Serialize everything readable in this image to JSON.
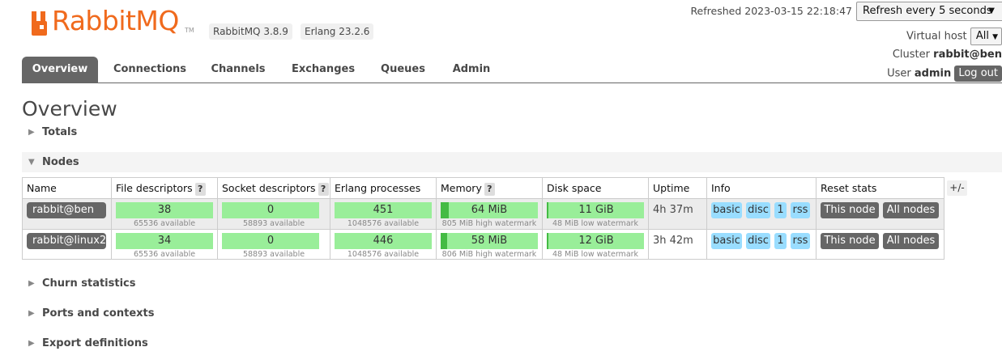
{
  "header": {
    "logo_text": "RabbitMQ",
    "logo_tm": "TM",
    "rabbitmq_version": "RabbitMQ 3.8.9",
    "erlang_version": "Erlang 23.2.6",
    "refreshed_label": "Refreshed 2023-03-15 22:18:47",
    "refresh_interval": "Refresh every 5 seconds",
    "virtual_host_label": "Virtual host",
    "virtual_host_value": "All",
    "cluster_label": "Cluster",
    "cluster_value": "rabbit@ben",
    "user_label": "User",
    "user_value": "admin",
    "logout_label": "Log out"
  },
  "tabs": [
    {
      "label": "Overview",
      "active": true
    },
    {
      "label": "Connections"
    },
    {
      "label": "Channels"
    },
    {
      "label": "Exchanges"
    },
    {
      "label": "Queues"
    },
    {
      "label": "Admin"
    }
  ],
  "page_title": "Overview",
  "sections": {
    "totals": "Totals",
    "nodes": "Nodes",
    "churn": "Churn statistics",
    "ports": "Ports and contexts",
    "export": "Export definitions"
  },
  "table": {
    "columns": {
      "name": "Name",
      "file_descriptors": "File descriptors",
      "socket_descriptors": "Socket descriptors",
      "erlang_processes": "Erlang processes",
      "memory": "Memory",
      "disk_space": "Disk space",
      "uptime": "Uptime",
      "info": "Info",
      "reset_stats": "Reset stats"
    },
    "help_glyph": "?",
    "toggle_columns": "+/-",
    "rows": [
      {
        "name": "rabbit@ben",
        "fd": "38",
        "fd_sub": "65536 available",
        "sockets": "0",
        "sockets_sub": "58893 available",
        "procs": "451",
        "procs_sub": "1048576 available",
        "memory": "64 MiB",
        "memory_sub": "805 MiB high watermark",
        "memory_fraction": 0.08,
        "disk": "11 GiB",
        "disk_sub": "48 MiB low watermark",
        "uptime": "4h 37m",
        "info": [
          "basic",
          "disc",
          "1",
          "rss"
        ],
        "reset": [
          "This node",
          "All nodes"
        ]
      },
      {
        "name": "rabbit@linux2",
        "fd": "34",
        "fd_sub": "65536 available",
        "sockets": "0",
        "sockets_sub": "58893 available",
        "procs": "446",
        "procs_sub": "1048576 available",
        "memory": "58 MiB",
        "memory_sub": "806 MiB high watermark",
        "memory_fraction": 0.07,
        "disk": "12 GiB",
        "disk_sub": "48 MiB low watermark",
        "uptime": "3h 42m",
        "info": [
          "basic",
          "disc",
          "1",
          "rss"
        ],
        "reset": [
          "This node",
          "All nodes"
        ]
      }
    ]
  },
  "colors": {
    "brand": "#f06a1d",
    "bar_ok": "#99ee99",
    "bar_fill": "#44bb44",
    "info_badge": "#99ddff",
    "dark_button": "#666666"
  }
}
